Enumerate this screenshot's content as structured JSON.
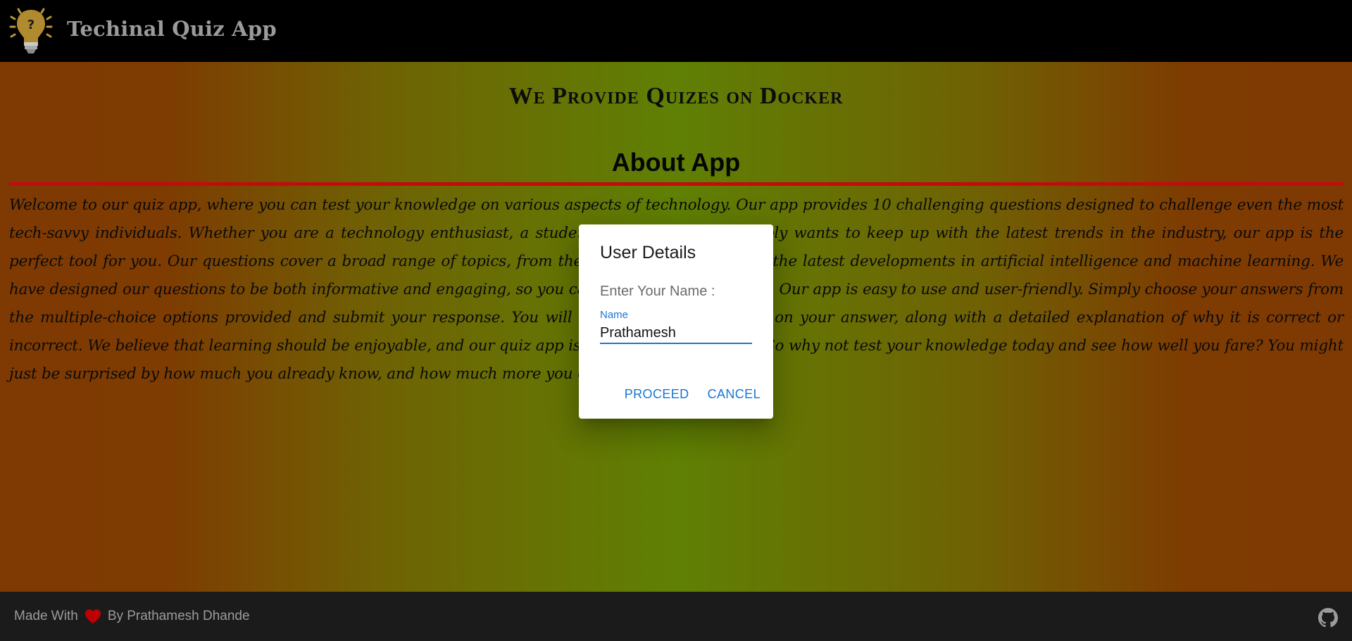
{
  "header": {
    "title": "Techinal Quiz App",
    "logo_icon": "lightbulb-question-icon"
  },
  "main": {
    "tagline": "We Provide Quizes on Docker",
    "section_title": "About App",
    "about_text": "Welcome to our quiz app, where you can test your knowledge on various aspects of technology. Our app provides 10 challenging questions designed to challenge even the most tech-savvy individuals. Whether you are a technology enthusiast, a student, or someone who simply wants to keep up with the latest trends in the industry, our app is the perfect tool for you. Our questions cover a broad range of topics, from the history of computing to the latest developments in artificial intelligence and machine learning. We have designed our questions to be both informative and engaging, so you can learn while having fun. Our app is easy to use and user-friendly. Simply choose your answers from the multiple-choice options provided and submit your response. You will receive instant feedback on your answer, along with a detailed explanation of why it is correct or incorrect. We believe that learning should be enjoyable, and our quiz app is designed to make it so. So why not test your knowledge today and see how well you fare? You might just be surprised by how much you already know, and how much more you can learn."
  },
  "dialog": {
    "title": "User Details",
    "prompt": "Enter Your Name :",
    "field_label": "Name",
    "name_value": "Prathamesh",
    "proceed_label": "Proceed",
    "cancel_label": "Cancel"
  },
  "footer": {
    "made_with": "Made With",
    "by_author": "By Prathamesh Dhande",
    "heart_icon": "heart-icon",
    "github_icon": "github-icon"
  },
  "colors": {
    "accent": "#1976d2",
    "divider": "#c20b0b",
    "heart": "#c00000",
    "header_bg": "#000000",
    "footer_bg": "#1b1b1b"
  }
}
